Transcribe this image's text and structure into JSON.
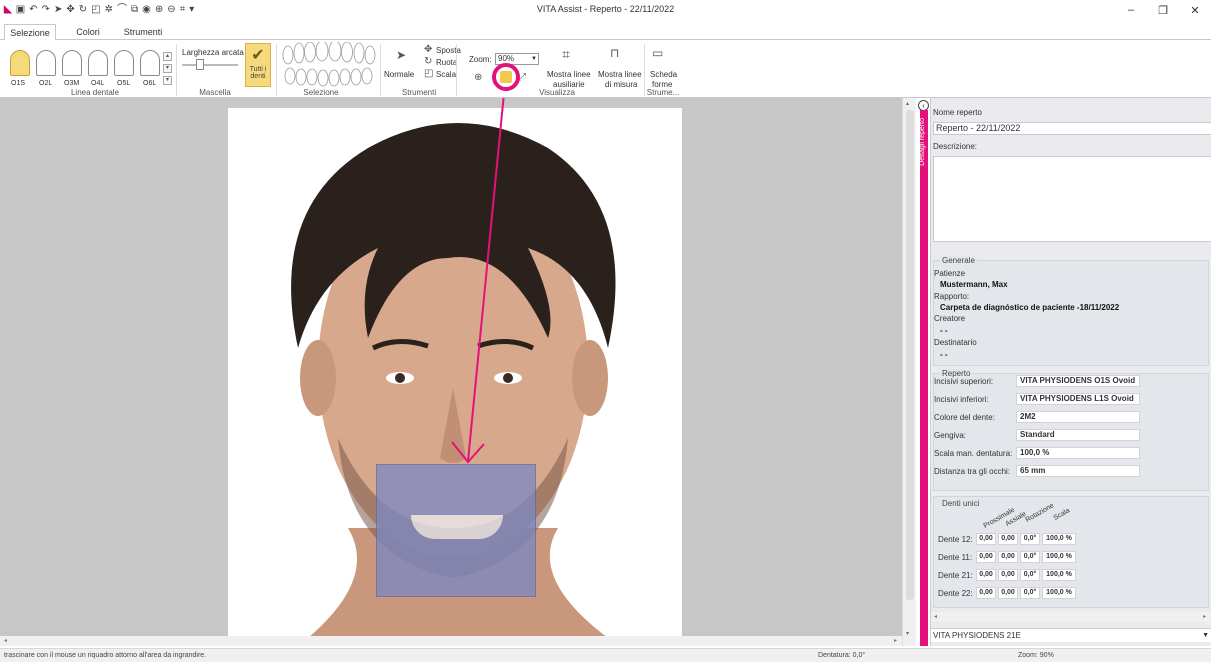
{
  "window": {
    "title": "VITA Assist - Reperto - 22/11/2022",
    "controls": [
      "–",
      "❐",
      "✕"
    ]
  },
  "tabs": [
    "Selezione",
    "Colori",
    "Strumenti"
  ],
  "ribbon": {
    "linea_dentale": {
      "label": "Linea dentale",
      "arches": [
        "O1S",
        "O2L",
        "O3M",
        "O4L",
        "O5L",
        "O6L"
      ],
      "selected": "O1S"
    },
    "mascella": {
      "label": "Mascella",
      "larghezza_label": "Larghezza arcata",
      "tutti_line1": "Tutti i",
      "tutti_line2": "denti"
    },
    "selezione": {
      "label": "Selezione"
    },
    "strumenti": {
      "label": "Strumenti",
      "normale": "Normale",
      "sposta": "Sposta",
      "ruota": "Ruota",
      "scala": "Scala"
    },
    "visualizza": {
      "label": "Visualizza",
      "zoom_label": "Zoom:",
      "zoom_value": "90%",
      "mostra_ausiliarie_1": "Mostra linee",
      "mostra_ausiliarie_2": "ausiliarie",
      "mostra_misura_1": "Mostra linee",
      "mostra_misura_2": "di misura"
    },
    "strume": {
      "label": "Strume...",
      "scheda_1": "Scheda",
      "scheda_2": "forme"
    }
  },
  "side_tab": "Dettagli reperto",
  "panel": {
    "nome_label": "Nome reperto",
    "nome_value": "Reperto - 22/11/2022",
    "descrizione_label": "Descrizione:",
    "generale": {
      "legend": "Generale",
      "patiente_label": "Patienze",
      "patiente_value": "Mustermann, Max",
      "rapporto_label": "Rapporto:",
      "rapporto_value": "Carpeta de diagnóstico de paciente -18/11/2022",
      "creatore_label": "Creatore",
      "creatore_value": "- -",
      "destinatario_label": "Destinatario",
      "destinatario_value": "- -"
    },
    "reperto": {
      "legend": "Reperto",
      "rows": [
        {
          "label": "Incisivi superiori:",
          "value": "VITA PHYSIODENS  O1S  Ovoid"
        },
        {
          "label": "Incisivi inferiori:",
          "value": "VITA PHYSIODENS  L1S  Ovoid"
        },
        {
          "label": "Colore del dente:",
          "value": "2M2"
        },
        {
          "label": "Gengiva:",
          "value": "Standard"
        },
        {
          "label": "Scala man. dentatura:",
          "value": "100,0 %"
        },
        {
          "label": "Distanza tra gli occhi:",
          "value": "65   mm"
        }
      ]
    },
    "denti_unici": {
      "legend": "Denti unici",
      "headers": [
        "Prossimale",
        "Assiale",
        "Rotazione",
        "Scala"
      ],
      "rows": [
        {
          "label": "Dente 12:",
          "values": [
            "0,00",
            "0,00",
            "0,0°",
            "100,0 %"
          ]
        },
        {
          "label": "Dente 11:",
          "values": [
            "0,00",
            "0,00",
            "0,0°",
            "100,0 %"
          ]
        },
        {
          "label": "Dente 21:",
          "values": [
            "0,00",
            "0,00",
            "0,0°",
            "100,0 %"
          ]
        },
        {
          "label": "Dente 22:",
          "values": [
            "0,00",
            "0,00",
            "0,0°",
            "100,0 %"
          ]
        }
      ]
    },
    "bottom_combo": "VITA PHYSIODENS  21E"
  },
  "statusbar": {
    "hint": "trascinare con il mouse un riquadro attorno all'area da ingrandire.",
    "dentatura": "Dentatura: 0,0°",
    "zoom": "Zoom: 90%"
  },
  "colors": {
    "accent": "#e2127a",
    "selected": "#f6d97a",
    "overlay": "#7b88c4"
  }
}
